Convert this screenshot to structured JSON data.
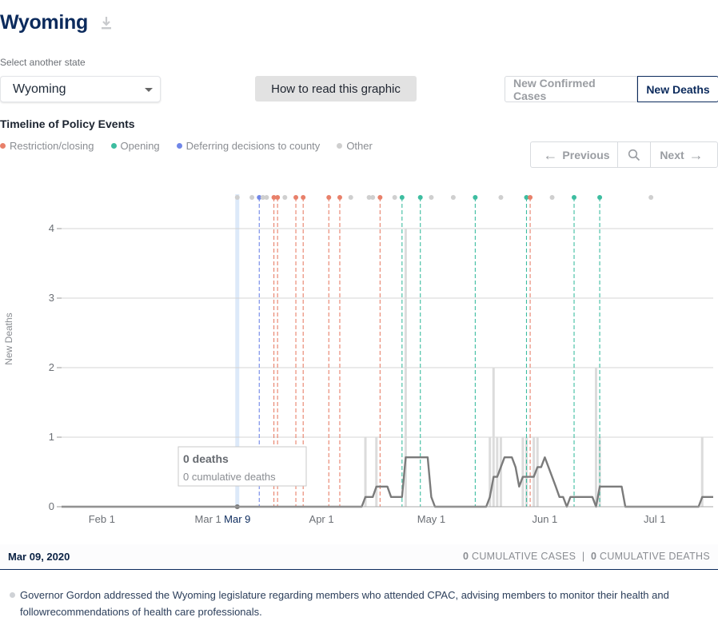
{
  "header": {
    "title": "Wyoming",
    "download_icon": "download-icon"
  },
  "state_select": {
    "label": "Select another state",
    "value": "Wyoming"
  },
  "howto_label": "How to read this graphic",
  "metric_toggle": {
    "cases_label": "New Confirmed Cases",
    "deaths_label": "New Deaths",
    "active": "New Deaths"
  },
  "timeline": {
    "title": "Timeline of Policy Events",
    "legend": [
      {
        "label": "Restriction/closing",
        "color": "#e8806a"
      },
      {
        "label": "Opening",
        "color": "#3dbda0"
      },
      {
        "label": "Deferring decisions to county",
        "color": "#7086e8"
      },
      {
        "label": "Other",
        "color": "#cfcfcf"
      }
    ]
  },
  "pager": {
    "prev_label": "Previous",
    "next_label": "Next",
    "search_icon": "search-icon"
  },
  "tooltip": {
    "title": "0 deaths",
    "sub": "0 cumulative deaths"
  },
  "footer": {
    "date": "Mar 09, 2020",
    "cases_num": "0",
    "cases_label": "CUMULATIVE CASES",
    "sep": "|",
    "deaths_num": "0",
    "deaths_label": "CUMULATIVE DEATHS"
  },
  "description": "Governor Gordon addressed the Wyoming legislature regarding members who attended CPAC, advising members to monitor their health and followrecommendations of health care professionals.",
  "chart_data": {
    "type": "bar",
    "title": "",
    "xlabel": "",
    "ylabel": "New Deaths",
    "x_start": "2020-01-21",
    "x_end": "2020-07-17",
    "ylim": [
      0,
      4.5
    ],
    "yticks": [
      0,
      1,
      2,
      3,
      4
    ],
    "xticks": [
      {
        "label": "Feb 1",
        "date": "2020-02-01"
      },
      {
        "label": "Mar 1",
        "date": "2020-03-01"
      },
      {
        "label": "Apr 1",
        "date": "2020-04-01"
      },
      {
        "label": "May 1",
        "date": "2020-05-01"
      },
      {
        "label": "Jun 1",
        "date": "2020-06-01"
      },
      {
        "label": "Jul 1",
        "date": "2020-07-01"
      }
    ],
    "highlight": {
      "label": "Mar 9",
      "date": "2020-03-09"
    },
    "grid": true,
    "daily_deaths": [
      {
        "date": "2020-04-13",
        "value": 1
      },
      {
        "date": "2020-04-16",
        "value": 1
      },
      {
        "date": "2020-04-24",
        "value": 4
      },
      {
        "date": "2020-05-17",
        "value": 1
      },
      {
        "date": "2020-05-18",
        "value": 2
      },
      {
        "date": "2020-05-19",
        "value": 1
      },
      {
        "date": "2020-05-20",
        "value": 1
      },
      {
        "date": "2020-05-26",
        "value": 1
      },
      {
        "date": "2020-05-27",
        "value": 1
      },
      {
        "date": "2020-05-29",
        "value": 1
      },
      {
        "date": "2020-05-30",
        "value": 1
      },
      {
        "date": "2020-06-15",
        "value": 2
      },
      {
        "date": "2020-06-16",
        "value": 1
      },
      {
        "date": "2020-07-14",
        "value": 1
      }
    ],
    "rolling_average": [
      {
        "date": "2020-01-21",
        "value": 0
      },
      {
        "date": "2020-04-12",
        "value": 0
      },
      {
        "date": "2020-04-13",
        "value": 0.14
      },
      {
        "date": "2020-04-15",
        "value": 0.14
      },
      {
        "date": "2020-04-16",
        "value": 0.29
      },
      {
        "date": "2020-04-19",
        "value": 0.29
      },
      {
        "date": "2020-04-20",
        "value": 0.14
      },
      {
        "date": "2020-04-22",
        "value": 0.14
      },
      {
        "date": "2020-04-23",
        "value": 0.14
      },
      {
        "date": "2020-04-24",
        "value": 0.71
      },
      {
        "date": "2020-04-30",
        "value": 0.71
      },
      {
        "date": "2020-05-01",
        "value": 0.14
      },
      {
        "date": "2020-05-02",
        "value": 0
      },
      {
        "date": "2020-05-16",
        "value": 0
      },
      {
        "date": "2020-05-17",
        "value": 0.14
      },
      {
        "date": "2020-05-18",
        "value": 0.43
      },
      {
        "date": "2020-05-19",
        "value": 0.43
      },
      {
        "date": "2020-05-20",
        "value": 0.57
      },
      {
        "date": "2020-05-21",
        "value": 0.71
      },
      {
        "date": "2020-05-23",
        "value": 0.71
      },
      {
        "date": "2020-05-24",
        "value": 0.57
      },
      {
        "date": "2020-05-25",
        "value": 0.29
      },
      {
        "date": "2020-05-26",
        "value": 0.43
      },
      {
        "date": "2020-05-29",
        "value": 0.43
      },
      {
        "date": "2020-05-30",
        "value": 0.57
      },
      {
        "date": "2020-05-31",
        "value": 0.57
      },
      {
        "date": "2020-06-01",
        "value": 0.71
      },
      {
        "date": "2020-06-02",
        "value": 0.57
      },
      {
        "date": "2020-06-04",
        "value": 0.29
      },
      {
        "date": "2020-06-05",
        "value": 0.14
      },
      {
        "date": "2020-06-06",
        "value": 0.14
      },
      {
        "date": "2020-06-07",
        "value": 0
      },
      {
        "date": "2020-06-08",
        "value": 0.14
      },
      {
        "date": "2020-06-14",
        "value": 0.14
      },
      {
        "date": "2020-06-15",
        "value": 0
      },
      {
        "date": "2020-06-16",
        "value": 0.29
      },
      {
        "date": "2020-06-22",
        "value": 0.29
      },
      {
        "date": "2020-06-23",
        "value": 0
      },
      {
        "date": "2020-07-13",
        "value": 0
      },
      {
        "date": "2020-07-14",
        "value": 0.14
      },
      {
        "date": "2020-07-17",
        "value": 0.14
      }
    ],
    "policy_events": [
      {
        "date": "2020-03-09",
        "type": "other"
      },
      {
        "date": "2020-03-13",
        "type": "other"
      },
      {
        "date": "2020-03-15",
        "type": "county"
      },
      {
        "date": "2020-03-16",
        "type": "other"
      },
      {
        "date": "2020-03-17",
        "type": "other"
      },
      {
        "date": "2020-03-19",
        "type": "restriction"
      },
      {
        "date": "2020-03-20",
        "type": "restriction"
      },
      {
        "date": "2020-03-22",
        "type": "other"
      },
      {
        "date": "2020-03-25",
        "type": "restriction"
      },
      {
        "date": "2020-03-27",
        "type": "restriction"
      },
      {
        "date": "2020-04-03",
        "type": "restriction"
      },
      {
        "date": "2020-04-06",
        "type": "restriction"
      },
      {
        "date": "2020-04-09",
        "type": "other"
      },
      {
        "date": "2020-04-14",
        "type": "other"
      },
      {
        "date": "2020-04-15",
        "type": "other"
      },
      {
        "date": "2020-04-17",
        "type": "restriction"
      },
      {
        "date": "2020-04-21",
        "type": "other"
      },
      {
        "date": "2020-04-23",
        "type": "opening"
      },
      {
        "date": "2020-04-28",
        "type": "opening"
      },
      {
        "date": "2020-05-01",
        "type": "other"
      },
      {
        "date": "2020-05-07",
        "type": "other"
      },
      {
        "date": "2020-05-13",
        "type": "opening"
      },
      {
        "date": "2020-05-20",
        "type": "other"
      },
      {
        "date": "2020-05-27",
        "type": "opening"
      },
      {
        "date": "2020-05-28",
        "type": "restriction"
      },
      {
        "date": "2020-06-03",
        "type": "other"
      },
      {
        "date": "2020-06-09",
        "type": "opening"
      },
      {
        "date": "2020-06-16",
        "type": "opening"
      },
      {
        "date": "2020-06-30",
        "type": "other"
      }
    ]
  }
}
